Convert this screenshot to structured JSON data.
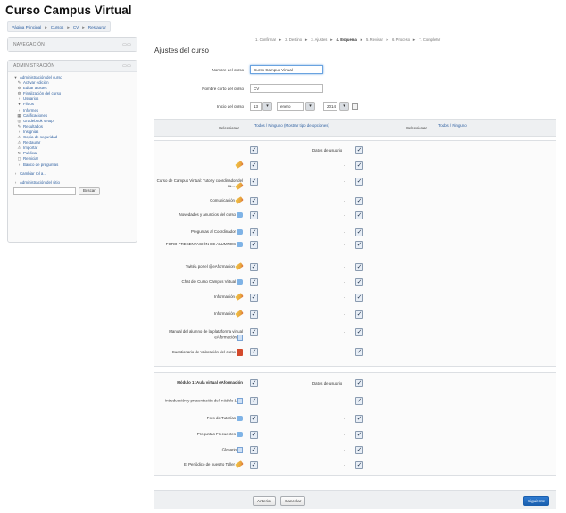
{
  "site_title": "Curso Campus Virtual",
  "breadcrumb": [
    "Página Principal",
    "Cursos",
    "CV",
    "Restaurar"
  ],
  "breadcrumb_sep": "►",
  "nav_block": {
    "title": "NAVEGACIÓN",
    "ctrl": "▭▭"
  },
  "admin_block": {
    "title": "ADMINISTRACIÓN",
    "ctrl": "▭▭",
    "section": "Administración del curso",
    "items": [
      {
        "icon": "✎",
        "label": "Activar edición"
      },
      {
        "icon": "⚙",
        "label": "Editar ajustes"
      },
      {
        "icon": "⚙",
        "label": "Finalización del curso"
      },
      {
        "icon": "›",
        "label": "Usuarios"
      },
      {
        "icon": "▼",
        "label": "Filtros"
      },
      {
        "icon": "›",
        "label": "Informes"
      },
      {
        "icon": "▦",
        "label": "Calificaciones"
      },
      {
        "icon": "◎",
        "label": "Gradebook setup"
      },
      {
        "icon": "✎",
        "label": "Resultados"
      },
      {
        "icon": "›",
        "label": "Insignias"
      },
      {
        "icon": "⚠",
        "label": "Copia de seguridad"
      },
      {
        "icon": "⚠",
        "label": "Restaurar"
      },
      {
        "icon": "⚠",
        "label": "Importar"
      },
      {
        "icon": "↻",
        "label": "Publicar"
      },
      {
        "icon": "◻",
        "label": "Reiniciar"
      },
      {
        "icon": "›",
        "label": "Banco de preguntas"
      }
    ],
    "switch_role": "Cambiar rol a...",
    "site_admin": "Administración del sitio",
    "search_button": "Buscar"
  },
  "steps": {
    "items": [
      "1. Confirmar",
      "2. Destino",
      "3. Ajustes",
      "4. Esquema",
      "5. Revisar",
      "6. Proceso",
      "7. Completar"
    ],
    "active_index": 3,
    "sep": "►"
  },
  "form": {
    "title": "Ajustes del curso",
    "full_name_label": "Nombre del curso",
    "full_name_value": "Curso Campus Virtual",
    "short_name_label": "Nombre corto del curso",
    "short_name_value": "CV",
    "start_label": "Inicio del curso",
    "start_day": "13",
    "start_month": "enero",
    "start_year": "2014",
    "select_label": "Seleccionar",
    "select_text": "Todos / Ninguno (Mostrar tipo de opciones)",
    "select_label_2": "Seleccionar",
    "select_text_2": "Todos / Ninguno",
    "user_data_label": "Datos de usuario",
    "dash": "-"
  },
  "section0_items": [
    {
      "label": "",
      "icon": "pencil"
    },
    {
      "label": "Curso de Campus Virtual: Tutor y coordinador del cu...",
      "icon": "pencil"
    },
    {
      "label": "Comunicación",
      "icon": "pencil"
    },
    {
      "label": "Novedades y anuncios del curso",
      "icon": "forum"
    },
    {
      "label": "Preguntas al Coordinador",
      "icon": "forum"
    },
    {
      "label": "FORO PRESENTACIÓN DE ALUMNOS",
      "icon": "forum"
    },
    {
      "label": "Twitéa por el @eAformacion",
      "icon": "pencil"
    },
    {
      "label": "Chat del Curso Campus Virtual",
      "icon": "forum"
    },
    {
      "label": "Información",
      "icon": "pencil"
    },
    {
      "label": "Información",
      "icon": "pencil"
    },
    {
      "label": "Manual del alumno de la plataforma virtual eAformación",
      "icon": "doc"
    },
    {
      "label": "Cuestionario de Valoración del curso",
      "icon": "quiz"
    }
  ],
  "section1": {
    "title": "Módulo 1: Aula virtual eAformación",
    "items": [
      {
        "label": "Introducción y presentación del módulo 1",
        "icon": "doc"
      },
      {
        "label": "Foro de Tutorías",
        "icon": "forum"
      },
      {
        "label": "Preguntas Frecuentes",
        "icon": "forum"
      },
      {
        "label": "Glosario",
        "icon": "doc"
      },
      {
        "label": "El Periódico de nuestro Taller",
        "icon": "pencil"
      }
    ]
  },
  "buttons": {
    "back": "Anterior",
    "cancel": "Cancelar",
    "next": "Siguiente"
  },
  "colors": {
    "link": "#2d5fa0",
    "primary": "#1a5fae"
  }
}
